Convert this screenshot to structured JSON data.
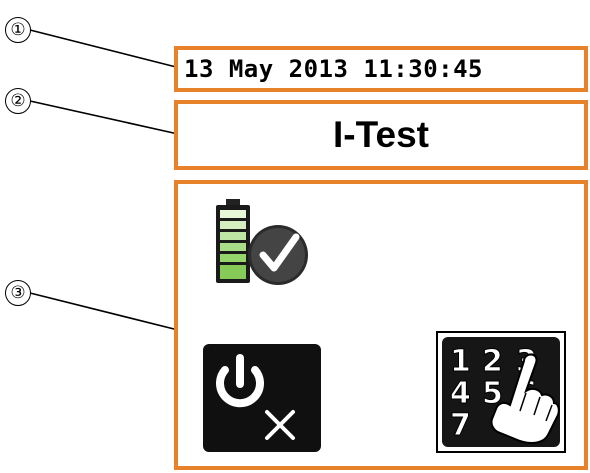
{
  "callouts": [
    "①",
    "②",
    "③"
  ],
  "status_bar": {
    "datetime": "13 May 2013 11:30:45"
  },
  "title_bar": {
    "title": "I-Test"
  },
  "main": {
    "icons": [
      "battery-ok-icon",
      "power-off-icon",
      "keypad-touch-icon"
    ],
    "keypad_digits": [
      "1",
      "2",
      "3",
      "4",
      "5",
      "6",
      "7"
    ]
  },
  "colors": {
    "frame": "#e8822a",
    "icon_dark": "#111111",
    "battery_green": "#8fd14f"
  }
}
